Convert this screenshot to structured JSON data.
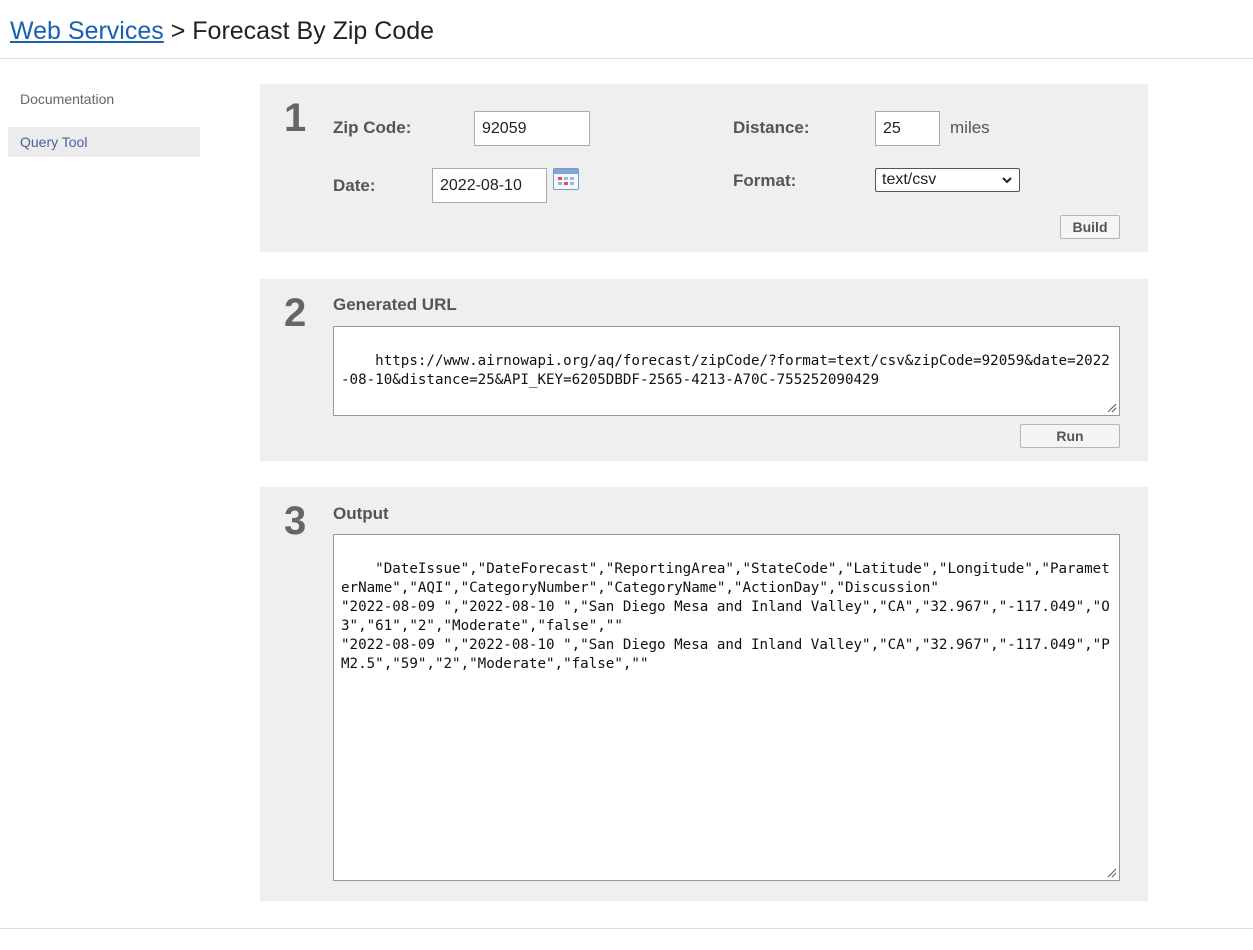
{
  "header": {
    "breadcrumb_link": "Web Services",
    "breadcrumb_sep": " > ",
    "page_title": "Forecast By Zip Code"
  },
  "sidebar": {
    "items": [
      {
        "label": "Documentation"
      },
      {
        "label": "Query Tool"
      }
    ]
  },
  "step1": {
    "number": "1",
    "zip_label": "Zip Code:",
    "zip_value": "92059",
    "distance_label": "Distance:",
    "distance_value": "25",
    "distance_unit": "miles",
    "date_label": "Date:",
    "date_value": "2022-08-10",
    "format_label": "Format:",
    "format_value": "text/csv",
    "build_label": "Build"
  },
  "step2": {
    "number": "2",
    "title": "Generated URL",
    "url": "https://www.airnowapi.org/aq/forecast/zipCode/?format=text/csv&zipCode=92059&date=2022-08-10&distance=25&API_KEY=6205DBDF-2565-4213-A70C-755252090429",
    "run_label": "Run"
  },
  "step3": {
    "number": "3",
    "title": "Output",
    "output": "\"DateIssue\",\"DateForecast\",\"ReportingArea\",\"StateCode\",\"Latitude\",\"Longitude\",\"ParameterName\",\"AQI\",\"CategoryNumber\",\"CategoryName\",\"ActionDay\",\"Discussion\"\n\"2022-08-09 \",\"2022-08-10 \",\"San Diego Mesa and Inland Valley\",\"CA\",\"32.967\",\"-117.049\",\"O3\",\"61\",\"2\",\"Moderate\",\"false\",\"\"\n\"2022-08-09 \",\"2022-08-10 \",\"San Diego Mesa and Inland Valley\",\"CA\",\"32.967\",\"-117.049\",\"PM2.5\",\"59\",\"2\",\"Moderate\",\"false\",\"\""
  },
  "icons": {
    "calendar": "calendar-icon",
    "select_arrow": "chevron-down-icon",
    "resize": "resize-grip-icon"
  }
}
